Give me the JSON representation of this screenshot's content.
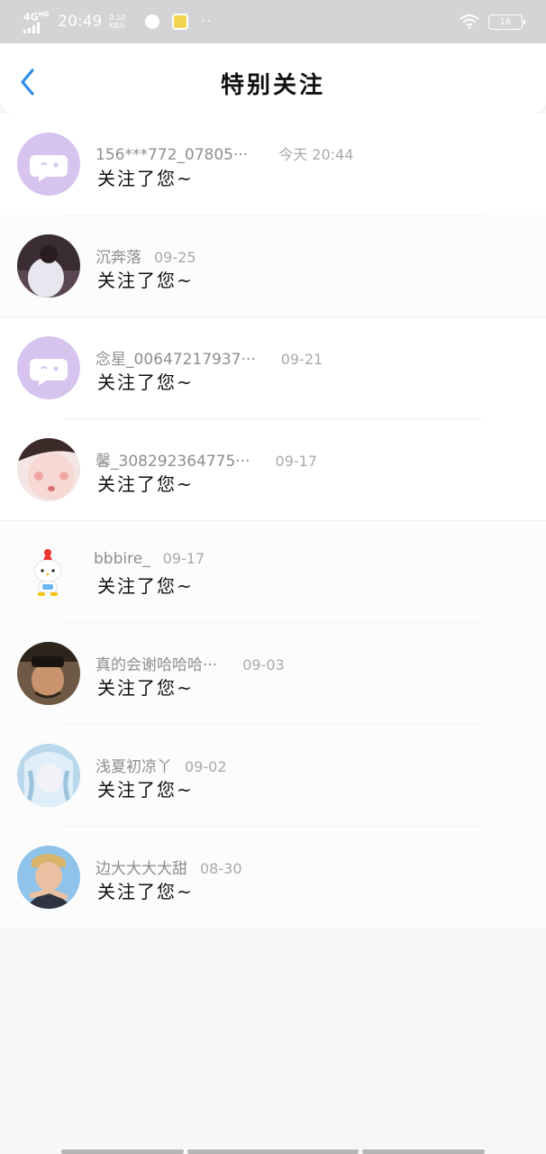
{
  "status_bar": {
    "network": "4G",
    "network_sup": "HD",
    "time": "20:49",
    "speed_value": "0.10",
    "speed_unit": "KB/s",
    "dots": "··",
    "battery": "16"
  },
  "header": {
    "title": "特别关注"
  },
  "list": [
    {
      "name": "156***772_07805···",
      "date": "今天 20:44",
      "message": "关注了您~",
      "avatar": "default-robot-avatar"
    },
    {
      "name": "沉奔落",
      "date": "09-25",
      "message": "关注了您~",
      "avatar": "user-photo-avatar"
    },
    {
      "name": "念星_00647217937···",
      "date": "09-21",
      "message": "关注了您~",
      "avatar": "default-robot-avatar"
    },
    {
      "name": "馨_308292364775···",
      "date": "09-17",
      "message": "关注了您~",
      "avatar": "user-photo-avatar"
    },
    {
      "name": "bbbire_",
      "date": "09-17",
      "message": "关注了您~",
      "avatar": "hello-kitty-avatar"
    },
    {
      "name": "真的会谢哈哈哈···",
      "date": "09-03",
      "message": "关注了您~",
      "avatar": "user-photo-avatar"
    },
    {
      "name": "浅夏初凉丫",
      "date": "09-02",
      "message": "关注了您~",
      "avatar": "anime-avatar"
    },
    {
      "name": "边大大大大甜",
      "date": "08-30",
      "message": "关注了您~",
      "avatar": "user-photo-avatar"
    }
  ],
  "colors": {
    "accent": "#2e8ce6",
    "default_avatar_bg": "#d6c3ee"
  }
}
